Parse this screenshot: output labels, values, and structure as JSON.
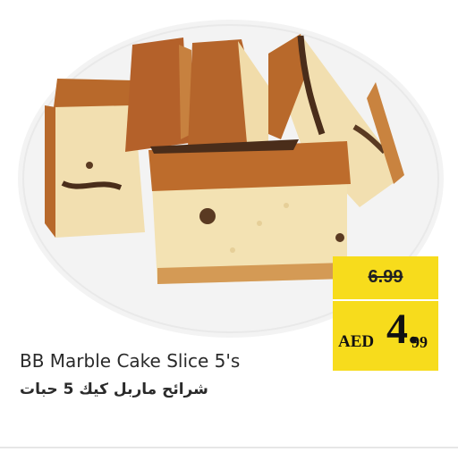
{
  "product": {
    "name_en": "BB Marble Cake Slice 5's",
    "name_ar": "شرائح ماربل كيك 5 حبات",
    "image_icon": "marble-cake-slices-image"
  },
  "price": {
    "old": "6.99",
    "currency": "AED",
    "whole": "4.",
    "decimal": "99"
  },
  "colors": {
    "tag_background": "#f7dc1c",
    "text": "#2a2a2a"
  }
}
